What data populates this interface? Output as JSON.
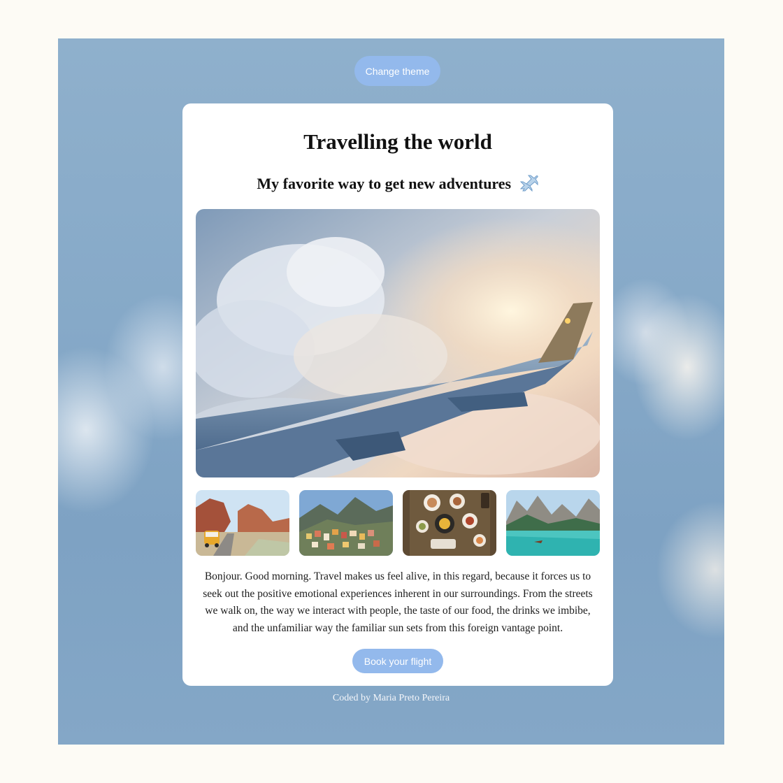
{
  "header": {
    "theme_button": "Change theme"
  },
  "card": {
    "title": "Travelling the world",
    "subtitle": "My favorite way to get new adventures",
    "subtitle_icon": "airplane-icon",
    "hero_image": "airplane-wing-above-clouds",
    "thumbnails": [
      "van-in-desert-canyon",
      "colorful-coastal-village",
      "table-of-food-dishes",
      "turquoise-mountain-lake"
    ],
    "description": "Bonjour. Good morning. Travel makes us feel alive, in this regard, because it forces us to seek out the positive emotional experiences inherent in our surroundings. From the streets we walk on, the way we interact with people, the taste of our food, the drinks we imbibe, and the unfamiliar way the familiar sun sets from this foreign vantage point.",
    "book_button": "Book your flight"
  },
  "footer": {
    "credit": "Coded by Maria Preto Pereira"
  },
  "colors": {
    "accent": "#93b9ec",
    "page_background": "#fdfbf5",
    "card_background": "#ffffff"
  }
}
